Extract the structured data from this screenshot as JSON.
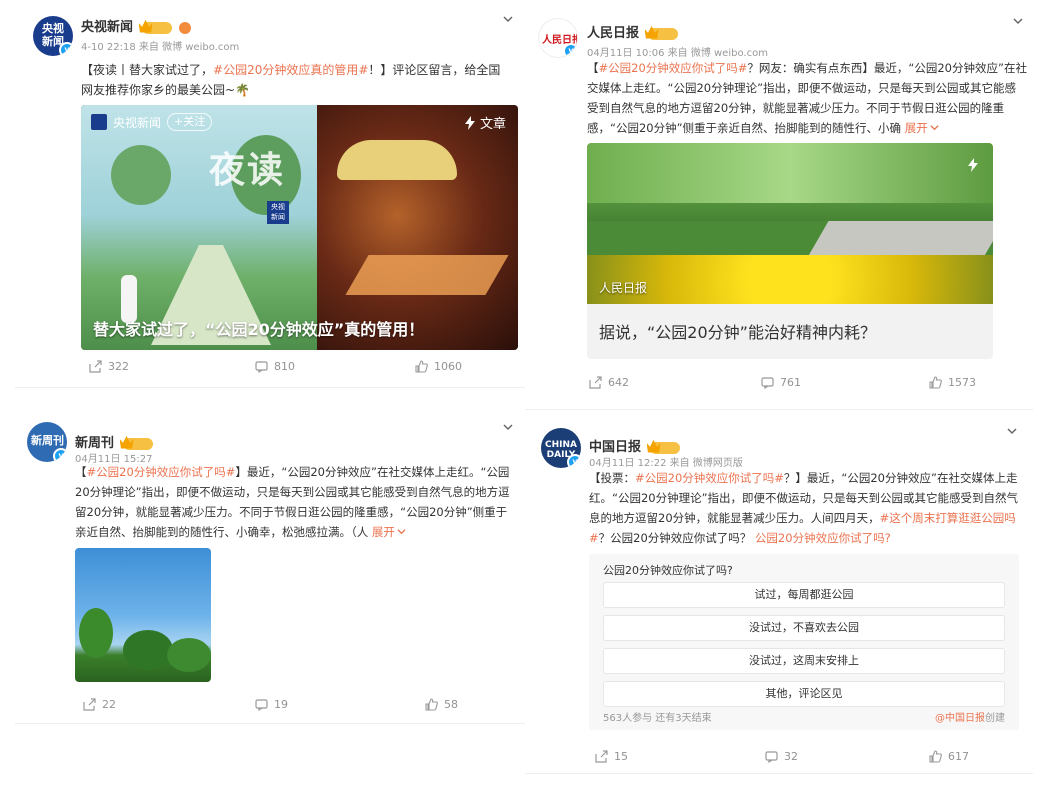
{
  "colors": {
    "accent": "#eb7350",
    "muted": "#939393",
    "verify": "#1da1f2"
  },
  "posts": [
    {
      "user": "央视新闻",
      "time": "4-10 22:18",
      "source_prefix": "来自",
      "source": "微博 weibo.com",
      "text_a": "【夜读丨替大家试过了，",
      "tag": "#公园20分钟效应真的管用#",
      "text_b": "！】评论区留言，给全国网友推荐你家乡的最美公园~🌴",
      "media_brand": "央视新闻",
      "media_follow": "+关注",
      "media_type": "文章",
      "media_caption": "替大家试过了，“公园20分钟效应”真的管用！",
      "media_night": "夜读",
      "repost": "322",
      "comment": "810",
      "like": "1060"
    },
    {
      "user": "人民日报",
      "time": "04月11日 10:06",
      "source_prefix": "来自",
      "source": "微博 weibo.com",
      "tag": "#公园20分钟效应你试了吗#",
      "text": "？网友：确实有点东西】最近，“公园20分钟效应”在社交媒体上走红。“公园20分钟理论”指出，即便不做运动，只是每天到公园或其它能感受到自然气息的地方逗留20分钟，就能显著减少压力。不同于节假日逛公园的隆重感，“公园20分钟”侧重于亲近自然、抬脚能到的随性行、小确",
      "text_prefix": "【",
      "expand": "展开",
      "media_label": "人民日报",
      "link_title": "据说，“公园20分钟”能治好精神内耗？",
      "repost": "642",
      "comment": "761",
      "like": "1573"
    },
    {
      "user": "新周刊",
      "time": "04月11日 15:27",
      "text_prefix": "【",
      "tag": "#公园20分钟效应你试了吗#",
      "text": "】最近，“公园20分钟效应”在社交媒体上走红。“公园20分钟理论”指出，即便不做运动，只是每天到公园或其它能感受到自然气息的地方逗留20分钟，就能显著减少压力。不同于节假日逛公园的隆重感，“公园20分钟”侧重于亲近自然、抬脚能到的随性行、小确幸，松弛感拉满。（人",
      "expand": "展开",
      "repost": "22",
      "comment": "19",
      "like": "58"
    },
    {
      "user": "中国日报",
      "time": "04月11日 12:22",
      "source_prefix": "来自",
      "source": "微博网页版",
      "text_prefix": "【投票：",
      "tag": "#公园20分钟效应你试了吗#",
      "text_mid": "？】最近，“公园20分钟效应”在社交媒体上走红。“公园20分钟理论”指出，即便不做运动，只是每天到公园或其它能感受到自然气息的地方逗留20分钟，就能显著减少压力。人间四月天，",
      "tag2": "#这个周末打算逛逛公园吗#",
      "text_end": "？公园20分钟效应你试了吗？",
      "poll_link": "公园20分钟效应你试了吗?",
      "poll_question": "公园20分钟效应你试了吗?",
      "poll_options": [
        "试过，每周都逛公园",
        "没试过，不喜欢去公园",
        "没试过，这周末安排上",
        "其他，评论区见"
      ],
      "poll_stats": "563人参与 还有3天结束",
      "poll_by_user": "@中国日报",
      "poll_by_suffix": "创建",
      "repost": "15",
      "comment": "32",
      "like": "617"
    }
  ]
}
